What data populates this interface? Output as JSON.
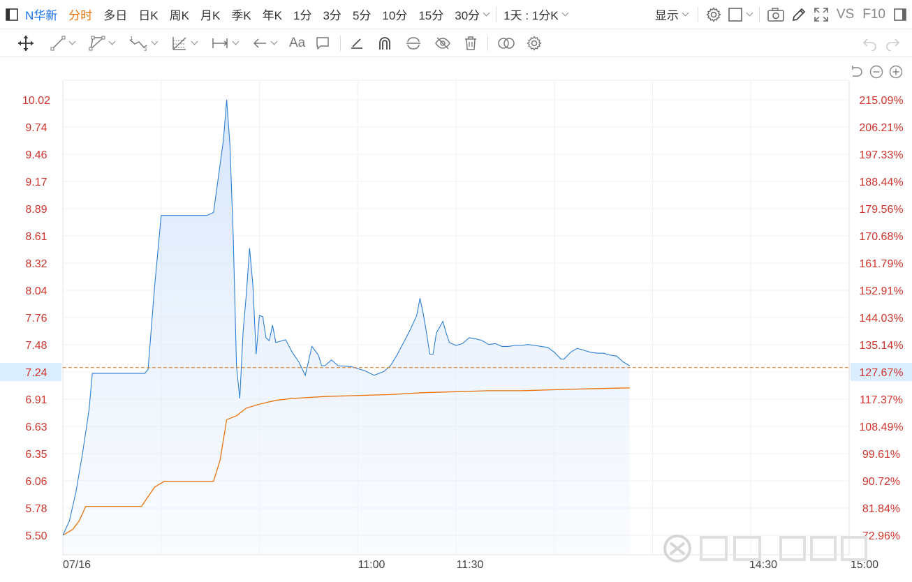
{
  "header": {
    "stock_name": "N华新",
    "periods": [
      "分时",
      "多日",
      "日K",
      "周K",
      "月K",
      "季K",
      "年K",
      "1分",
      "3分",
      "5分",
      "10分",
      "15分"
    ],
    "dropdown_period": "30分",
    "kline_range": "1天 : 1分K",
    "display_label": "显示",
    "vs_label": "VS",
    "f10_label": "F10"
  },
  "drawing_tools": {
    "text_tool_label": "Aa"
  },
  "chart_data": {
    "type": "line",
    "x_tick_labels": [
      "07/16",
      "11:00",
      "11:30",
      "14:30",
      "15:00"
    ],
    "y_left_ticks": [
      "10.02",
      "9.74",
      "9.46",
      "9.17",
      "8.89",
      "8.61",
      "8.32",
      "8.04",
      "7.76",
      "7.48",
      "7.24",
      "6.91",
      "6.63",
      "6.35",
      "6.06",
      "5.78",
      "5.50"
    ],
    "y_right_ticks": [
      "215.09%",
      "206.21%",
      "197.33%",
      "188.44%",
      "179.56%",
      "170.68%",
      "161.79%",
      "152.91%",
      "144.03%",
      "135.14%",
      "127.67%",
      "117.37%",
      "108.49%",
      "99.61%",
      "90.72%",
      "81.84%",
      "72.96%"
    ],
    "ylim": [
      5.5,
      10.02
    ],
    "reference_price": "7.24",
    "reference_percent": "127.67%",
    "x_minutes_total": 240,
    "series": [
      {
        "kind": "price",
        "color": "#2d7fd4",
        "points": [
          [
            0,
            5.5
          ],
          [
            2,
            5.65
          ],
          [
            4,
            5.95
          ],
          [
            6,
            6.35
          ],
          [
            8,
            6.8
          ],
          [
            9,
            7.18
          ],
          [
            11,
            7.18
          ],
          [
            16,
            7.18
          ],
          [
            20,
            7.18
          ],
          [
            25,
            7.18
          ],
          [
            26,
            7.22
          ],
          [
            28,
            8.08
          ],
          [
            30,
            8.82
          ],
          [
            36,
            8.82
          ],
          [
            44,
            8.82
          ],
          [
            46,
            8.85
          ],
          [
            47,
            9.1
          ],
          [
            49,
            9.6
          ],
          [
            50,
            10.02
          ],
          [
            51,
            9.55
          ],
          [
            52,
            8.6
          ],
          [
            53,
            7.25
          ],
          [
            54,
            6.92
          ],
          [
            55,
            7.6
          ],
          [
            56,
            8.0
          ],
          [
            57,
            8.48
          ],
          [
            58,
            8.1
          ],
          [
            59,
            7.38
          ],
          [
            60,
            7.78
          ],
          [
            61,
            7.77
          ],
          [
            62,
            7.55
          ],
          [
            63,
            7.52
          ],
          [
            64,
            7.68
          ],
          [
            65,
            7.5
          ],
          [
            66,
            7.51
          ],
          [
            68,
            7.53
          ],
          [
            70,
            7.4
          ],
          [
            72,
            7.3
          ],
          [
            74,
            7.16
          ],
          [
            76,
            7.46
          ],
          [
            78,
            7.37
          ],
          [
            79,
            7.26
          ],
          [
            80,
            7.26
          ],
          [
            82,
            7.32
          ],
          [
            84,
            7.26
          ],
          [
            88,
            7.25
          ],
          [
            92,
            7.21
          ],
          [
            95,
            7.16
          ],
          [
            98,
            7.2
          ],
          [
            100,
            7.26
          ],
          [
            102,
            7.37
          ],
          [
            104,
            7.5
          ],
          [
            106,
            7.63
          ],
          [
            108,
            7.78
          ],
          [
            109,
            7.96
          ],
          [
            110,
            7.8
          ],
          [
            111,
            7.6
          ],
          [
            112,
            7.38
          ],
          [
            113,
            7.38
          ],
          [
            114,
            7.6
          ],
          [
            116,
            7.72
          ],
          [
            117,
            7.6
          ],
          [
            118,
            7.5
          ],
          [
            120,
            7.47
          ],
          [
            122,
            7.49
          ],
          [
            124,
            7.55
          ],
          [
            126,
            7.54
          ],
          [
            128,
            7.52
          ],
          [
            130,
            7.48
          ],
          [
            132,
            7.49
          ],
          [
            134,
            7.46
          ],
          [
            136,
            7.46
          ],
          [
            138,
            7.47
          ],
          [
            140,
            7.47
          ],
          [
            142,
            7.48
          ],
          [
            144,
            7.47
          ],
          [
            146,
            7.46
          ],
          [
            148,
            7.45
          ],
          [
            150,
            7.4
          ],
          [
            152,
            7.33
          ],
          [
            153,
            7.33
          ],
          [
            155,
            7.4
          ],
          [
            157,
            7.44
          ],
          [
            159,
            7.42
          ],
          [
            161,
            7.4
          ],
          [
            163,
            7.39
          ],
          [
            165,
            7.39
          ],
          [
            167,
            7.37
          ],
          [
            169,
            7.36
          ],
          [
            171,
            7.3
          ],
          [
            173,
            7.26
          ]
        ]
      },
      {
        "kind": "average",
        "color": "#e8730c",
        "points": [
          [
            0,
            5.5
          ],
          [
            3,
            5.56
          ],
          [
            5,
            5.65
          ],
          [
            7,
            5.8
          ],
          [
            12,
            5.8
          ],
          [
            20,
            5.8
          ],
          [
            24,
            5.8
          ],
          [
            28,
            6.0
          ],
          [
            31,
            6.06
          ],
          [
            40,
            6.06
          ],
          [
            46,
            6.06
          ],
          [
            48,
            6.28
          ],
          [
            50,
            6.7
          ],
          [
            53,
            6.74
          ],
          [
            56,
            6.82
          ],
          [
            60,
            6.86
          ],
          [
            65,
            6.9
          ],
          [
            70,
            6.92
          ],
          [
            80,
            6.94
          ],
          [
            90,
            6.95
          ],
          [
            100,
            6.96
          ],
          [
            110,
            6.98
          ],
          [
            120,
            6.99
          ],
          [
            130,
            7.0
          ],
          [
            140,
            7.0
          ],
          [
            150,
            7.01
          ],
          [
            160,
            7.02
          ],
          [
            173,
            7.03
          ]
        ]
      }
    ]
  }
}
